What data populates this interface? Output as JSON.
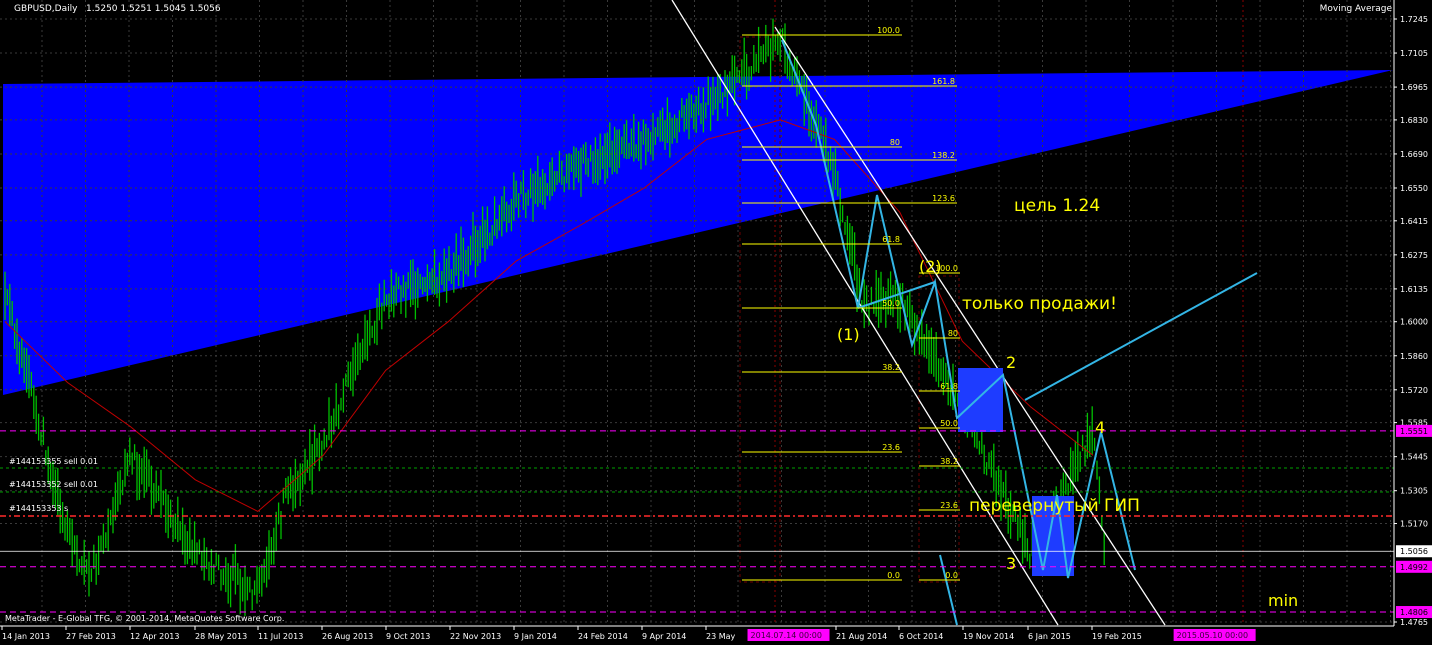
{
  "header": {
    "symbol_label": "GBPUSD,Daily",
    "ohlc": "1.5250 1.5251 1.5045 1.5056",
    "indicator_label": "Moving Average",
    "copyright": "MetaTrader - E-Global TFG, © 2001-2014, MetaQuotes Software Corp."
  },
  "orders": [
    "#144153355 sell 0.01",
    "#144153352 sell 0.01",
    "#144153353 s"
  ],
  "chart_data": {
    "type": "candlestick",
    "symbol": "GBPUSD",
    "timeframe": "Daily",
    "y_ticks": [
      1.7245,
      1.7105,
      1.6965,
      1.683,
      1.669,
      1.655,
      1.6415,
      1.6275,
      1.6135,
      1.6,
      1.586,
      1.572,
      1.5585,
      1.5445,
      1.5305,
      1.517,
      1.4765
    ],
    "price_markers": [
      {
        "price": 1.5551,
        "label": "1.5551",
        "color": "#ff00ff"
      },
      {
        "price": 1.5056,
        "label": "1.5056",
        "color": "#ffffff"
      },
      {
        "price": 1.4992,
        "label": "1.4992",
        "color": "#ff00ff"
      },
      {
        "price": 1.4806,
        "label": "1.4806",
        "color": "#ff00ff"
      }
    ],
    "x_ticks": [
      "14 Jan 2013",
      "27 Feb 2013",
      "12 Apr 2013",
      "28 May 2013",
      "11 Jul 2013",
      "26 Aug 2013",
      "9 Oct 2013",
      "22 Nov 2013",
      "9 Jan 2014",
      "24 Feb 2014",
      "9 Apr 2014",
      "23 May",
      "21 Aug 2014",
      "6 Oct 2014",
      "19 Nov 2014",
      "6 Jan 2015",
      "19 Feb 2015"
    ],
    "x_markers": [
      "2014.07.14 00:00",
      "2015.05.10 00:00"
    ],
    "price_path": [
      [
        "14 Jan 2013",
        1.612
      ],
      [
        "27 Feb 2013",
        1.513
      ],
      [
        "15 Mar 2013",
        1.495
      ],
      [
        "12 Apr 2013",
        1.545
      ],
      [
        "28 May 2013",
        1.505
      ],
      [
        "11 Jul 2013",
        1.488
      ],
      [
        "1 Aug 2013",
        1.53
      ],
      [
        "26 Aug 2013",
        1.55
      ],
      [
        "9 Oct 2013",
        1.61
      ],
      [
        "22 Nov 2013",
        1.62
      ],
      [
        "9 Jan 2014",
        1.65
      ],
      [
        "24 Feb 2014",
        1.665
      ],
      [
        "9 Apr 2014",
        1.675
      ],
      [
        "23 May 2014",
        1.69
      ],
      [
        "14 Jul 2014",
        1.715
      ],
      [
        "21 Aug 2014",
        1.663
      ],
      [
        "10 Sep 2014",
        1.606
      ],
      [
        "6 Oct 2014",
        1.61
      ],
      [
        "19 Nov 2014",
        1.565
      ],
      [
        "6 Jan 2015",
        1.505
      ],
      [
        "19 Feb 2015",
        1.555
      ],
      [
        "27 Feb 2015",
        1.5056
      ]
    ],
    "moving_average": [
      [
        "14 Jan 2013",
        1.6
      ],
      [
        "27 Feb 2013",
        1.575
      ],
      [
        "12 Apr 2013",
        1.557
      ],
      [
        "28 May 2013",
        1.535
      ],
      [
        "11 Jul 2013",
        1.522
      ],
      [
        "26 Aug 2013",
        1.545
      ],
      [
        "9 Oct 2013",
        1.58
      ],
      [
        "22 Nov 2013",
        1.6
      ],
      [
        "9 Jan 2014",
        1.625
      ],
      [
        "24 Feb 2014",
        1.64
      ],
      [
        "9 Apr 2014",
        1.655
      ],
      [
        "23 May 2014",
        1.675
      ],
      [
        "14 Jul 2014",
        1.683
      ],
      [
        "21 Aug 2014",
        1.675
      ],
      [
        "6 Oct 2014",
        1.645
      ],
      [
        "19 Nov 2014",
        1.592
      ],
      [
        "6 Jan 2015",
        1.565
      ],
      [
        "19 Feb 2015",
        1.545
      ]
    ],
    "fibonacci_sets": [
      {
        "levels": [
          "100.0",
          "161.8",
          "80",
          "138.2",
          "123.6",
          "61.8",
          "50.0",
          "38.2",
          "23.6",
          "0.0"
        ]
      },
      {
        "levels": [
          "100.0",
          "80",
          "61.8",
          "50.0",
          "38.2",
          "23.6",
          "0.0"
        ]
      }
    ],
    "annotations": [
      {
        "text": "цель 1.24",
        "color": "#ffff00"
      },
      {
        "text": "только продажи!",
        "color": "#ffff00"
      },
      {
        "text": "перевернутый ГИП",
        "color": "#ffff00"
      },
      {
        "text": "min",
        "color": "#ffff00"
      },
      {
        "text": "(1)",
        "color": "#ffff00"
      },
      {
        "text": "(2)",
        "color": "#ffff00"
      },
      {
        "text": "2",
        "color": "#ffff00"
      },
      {
        "text": "3",
        "color": "#ffff00"
      },
      {
        "text": "4",
        "color": "#ffff00"
      }
    ],
    "colors": {
      "background": "#000000",
      "candles": "#00c000",
      "moving_average": "#c00000",
      "channel": "#0000ff",
      "trendline": "#ffffff",
      "wave": "#33b5e5",
      "fibo": "#ffff00",
      "marker": "#ff00ff"
    },
    "grid": true
  }
}
